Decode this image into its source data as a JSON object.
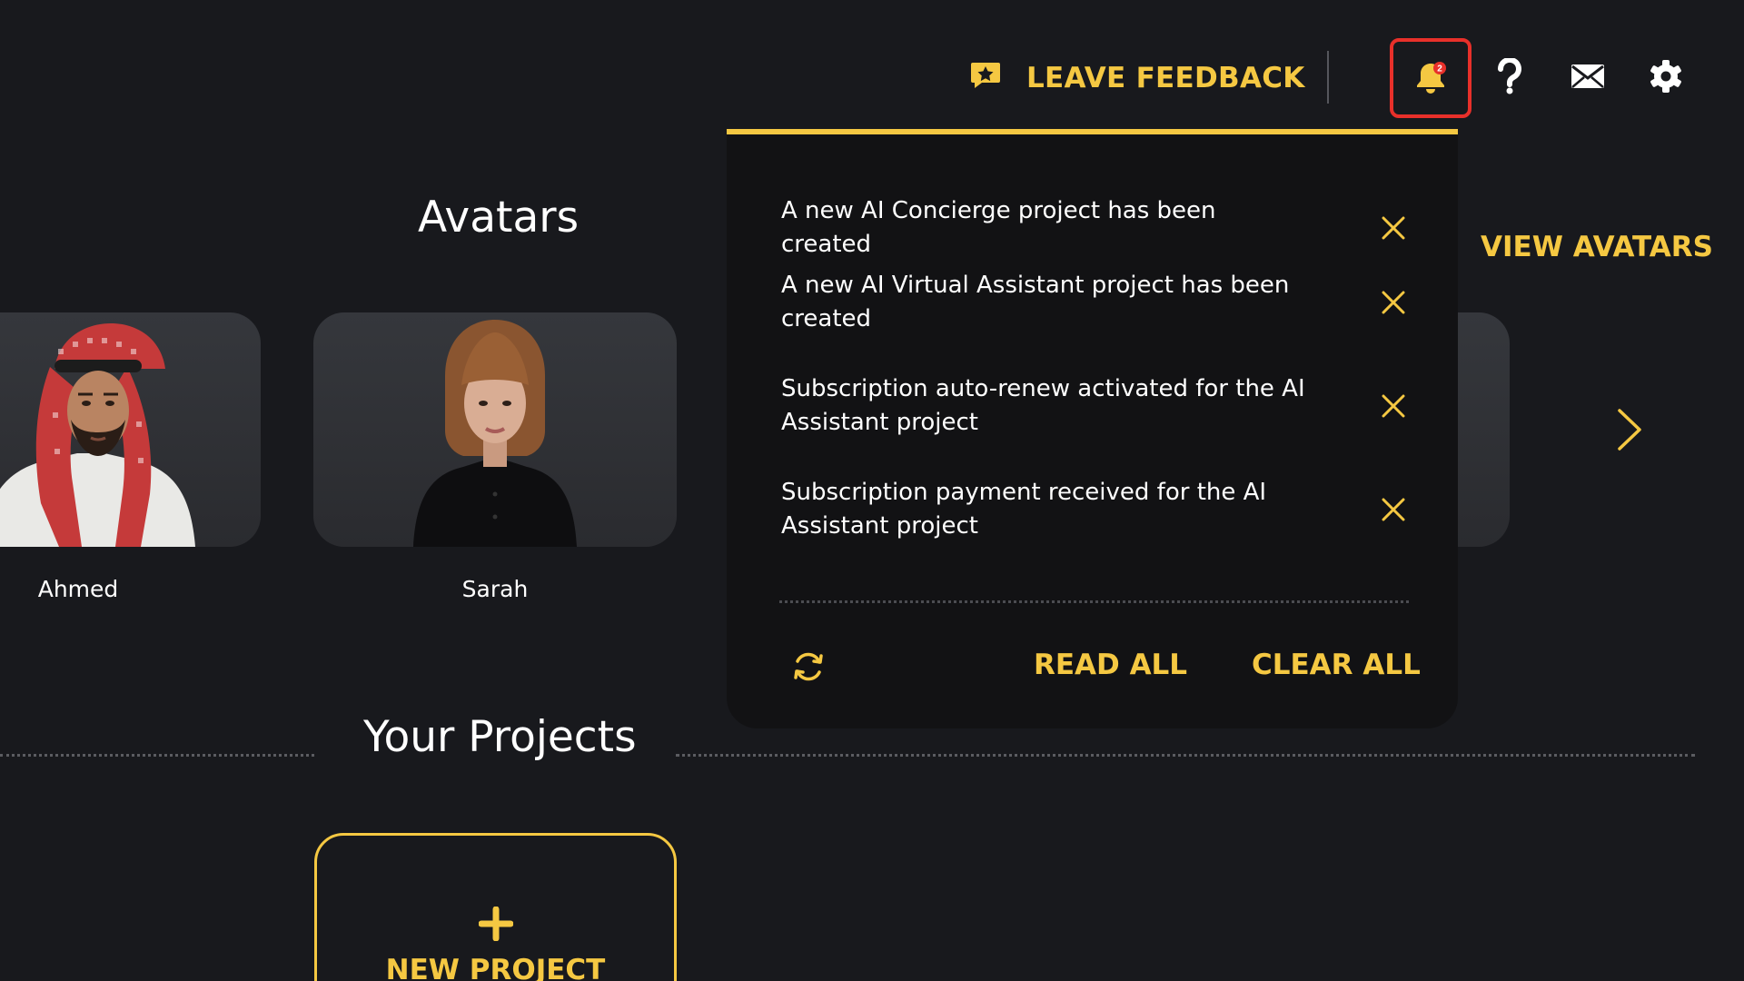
{
  "header": {
    "feedback_label": "LEAVE FEEDBACK",
    "notification_badge": "2",
    "icons": [
      "feedback-star-icon",
      "bell-icon",
      "help-icon",
      "mail-icon",
      "gear-icon"
    ]
  },
  "avatars": {
    "title": "Avatars",
    "view_link": "VIEW AVATARS",
    "items": [
      {
        "name": "Ahmed"
      },
      {
        "name": "Sarah"
      }
    ]
  },
  "projects": {
    "title": "Your Projects",
    "new_project_label": "NEW PROJECT"
  },
  "notifications": {
    "items": [
      {
        "text": "A new AI Concierge project has been created"
      },
      {
        "text": "A new AI Virtual Assistant project has been created"
      },
      {
        "text": "Subscription auto-renew activated for the AI Assistant project"
      },
      {
        "text": "Subscription payment received for the AI Assistant project"
      }
    ],
    "read_all": "READ ALL",
    "clear_all": "CLEAR ALL"
  },
  "colors": {
    "background": "#18191d",
    "panel": "#121214",
    "accent": "#f5c842",
    "highlight_border": "#e8302a",
    "badge": "#e8302a"
  }
}
